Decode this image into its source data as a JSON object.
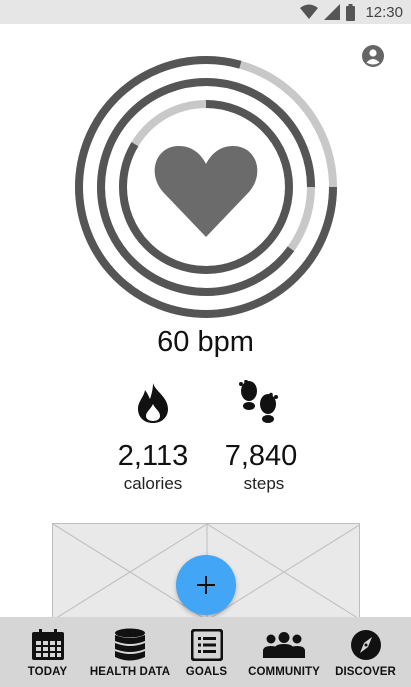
{
  "status_bar": {
    "time": "12:30",
    "icons": [
      "wifi-icon",
      "cell-signal-icon",
      "battery-icon"
    ]
  },
  "header": {
    "account_icon": "account-circle-icon"
  },
  "activity_rings": {
    "center_icon": "heart-icon",
    "colors": {
      "ring_progress": "#555555",
      "ring_track": "#c8c8c8",
      "heart": "#6b6b6b"
    }
  },
  "heart_rate": {
    "label": "60 bpm"
  },
  "stats": [
    {
      "icon": "flame-icon",
      "value": "2,113",
      "label": "calories"
    },
    {
      "icon": "footprints-icon",
      "value": "7,840",
      "label": "steps"
    }
  ],
  "fab": {
    "icon": "plus-icon",
    "label": "+",
    "color": "#42a5f5"
  },
  "bottom_nav": {
    "items": [
      {
        "label": "TODAY",
        "icon": "calendar-icon"
      },
      {
        "label": "HEALTH DATA",
        "icon": "database-icon"
      },
      {
        "label": "GOALS",
        "icon": "list-icon"
      },
      {
        "label": "COMMUNITY",
        "icon": "people-icon"
      },
      {
        "label": "DISCOVER",
        "icon": "compass-icon"
      }
    ]
  }
}
